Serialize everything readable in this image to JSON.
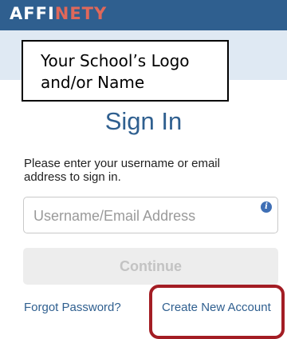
{
  "header": {
    "brand_part1": "AFFI",
    "brand_part2": "NETY",
    "accent_color": "#e0685a",
    "bar_color": "#2f5f8f"
  },
  "logo_placeholder": {
    "line1": "Your School’s Logo",
    "line2": "and/or Name"
  },
  "signin": {
    "title": "Sign In",
    "instructions": "Please enter your username or email address to sign in.",
    "username_placeholder": "Username/Email Address",
    "username_value": "",
    "info_icon": "info-icon",
    "continue_label": "Continue"
  },
  "links": {
    "forgot_password": "Forgot Password?",
    "create_account": "Create New Account"
  },
  "annotation": {
    "highlight_color": "#a31d24"
  }
}
